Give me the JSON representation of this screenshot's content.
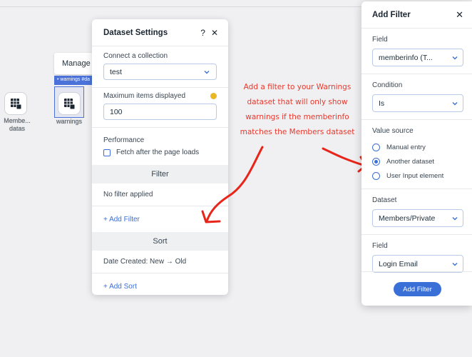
{
  "canvas": {
    "dataset1_label": "Membe... datas",
    "dataset2_label": "warnings",
    "manage_tag": "Manage C",
    "selection_tag": "• warnings #da"
  },
  "dataset_settings": {
    "title": "Dataset Settings",
    "help_label": "?",
    "close_label": "✕",
    "connect_label": "Connect a collection",
    "collection_value": "test",
    "max_items_label": "Maximum items displayed",
    "max_items_value": "100",
    "performance_label": "Performance",
    "fetch_label": "Fetch after the page loads",
    "filter_header": "Filter",
    "no_filter_text": "No filter applied",
    "add_filter_link": "+ Add Filter",
    "sort_header": "Sort",
    "sort_value": "Date Created: New → Old",
    "add_sort_link": "+ Add Sort"
  },
  "annotation": {
    "text": "Add a filter to your Warnings dataset that will only show warnings if the memberinfo matches the Members dataset",
    "color": "#e8382c"
  },
  "add_filter": {
    "title": "Add Filter",
    "close_label": "✕",
    "field_label": "Field",
    "field_value": "memberinfo (T...",
    "condition_label": "Condition",
    "condition_value": "Is",
    "value_source_label": "Value source",
    "options": [
      {
        "label": "Manual entry",
        "selected": false
      },
      {
        "label": "Another dataset",
        "selected": true
      },
      {
        "label": "User Input element",
        "selected": false
      }
    ],
    "dataset_label": "Dataset",
    "dataset_value": "Members/Private",
    "field2_label": "Field",
    "field2_value": "Login Email",
    "button_label": "Add Filter",
    "accent": "#3b6fd8"
  }
}
